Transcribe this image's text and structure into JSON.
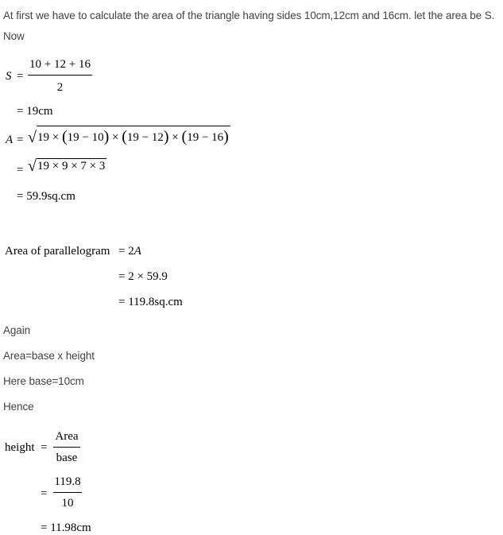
{
  "intro": "At first we have to calculate the area of the triangle having sides 10cm,12cm and 16cm. let the area be S.",
  "now": "Now",
  "s_formula": {
    "lhs": "S",
    "eq": "=",
    "numerator": "10 + 12 + 16",
    "denominator": "2",
    "result": "= 19cm"
  },
  "area_formula": {
    "lhs": "A",
    "eq": "=",
    "radicand1": [
      "19 × ",
      "(",
      "19 − 10",
      ")",
      " × ",
      "(",
      "19 − 12",
      ")",
      " × ",
      "(",
      "19 − 16",
      ")"
    ],
    "step2_eq": "=",
    "radicand2": "19 × 9 × 7 × 3",
    "result": "= 59.9sq.cm"
  },
  "parallelogram": {
    "label": "Area of parallelogram",
    "line1": "= 2",
    "line1_var": "A",
    "line2": "= 2 × 59.9",
    "line3": "= 119.8sq.cm"
  },
  "again": "Again",
  "area_def": "Area=base x height",
  "base_def": "Here base=10cm",
  "hence": "Hence",
  "height_formula": {
    "lhs": "height",
    "eq": "=",
    "num1": "Area",
    "den1": "base",
    "eq2": "=",
    "num2": "119.8",
    "den2": "10",
    "result": "= 11.98cm"
  }
}
